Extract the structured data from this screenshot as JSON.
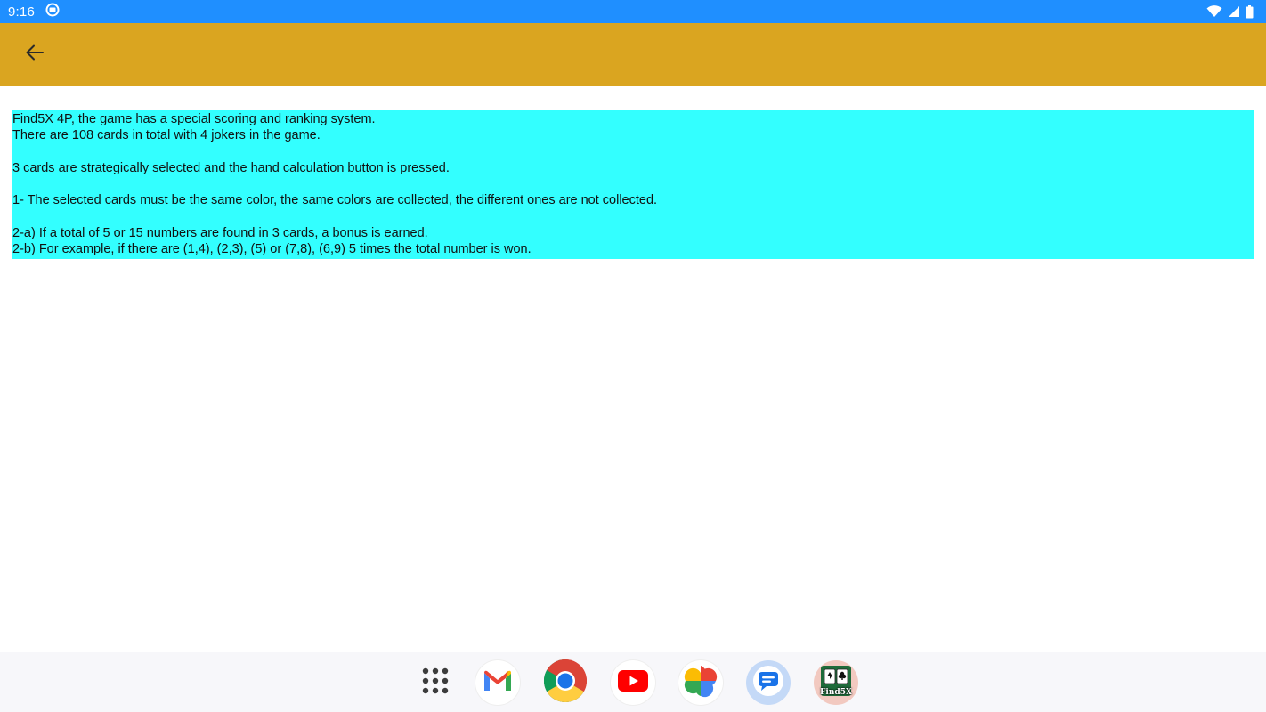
{
  "status_bar": {
    "time": "9:16",
    "background": "#1f8fff",
    "icons": [
      "notification-icon",
      "wifi-icon",
      "signal-icon",
      "battery-icon"
    ]
  },
  "app_bar": {
    "background": "#daa520",
    "back_icon": "arrow-left-icon"
  },
  "content": {
    "background": "#33ffff",
    "lines": [
      "Find5X 4P, the game has a special scoring and ranking system.",
      "There are 108 cards in total with 4 jokers in the game.",
      "",
      "3 cards are strategically selected and the hand calculation button is pressed.",
      "",
      "1- The selected cards must be the same color, the same colors are collected, the different ones are not collected.",
      "",
      "2-a) If a total of 5 or 15 numbers are found in 3 cards, a bonus is earned.",
      "2-b) For example, if there are (1,4), (2,3), (5) or (7,8), (6,9) 5 times the total number is won."
    ]
  },
  "dock": {
    "apps": [
      "app-drawer-icon",
      "gmail-icon",
      "chrome-icon",
      "youtube-icon",
      "photos-icon",
      "messages-icon",
      "find5x-icon"
    ],
    "find5x_label": "Find5X"
  }
}
